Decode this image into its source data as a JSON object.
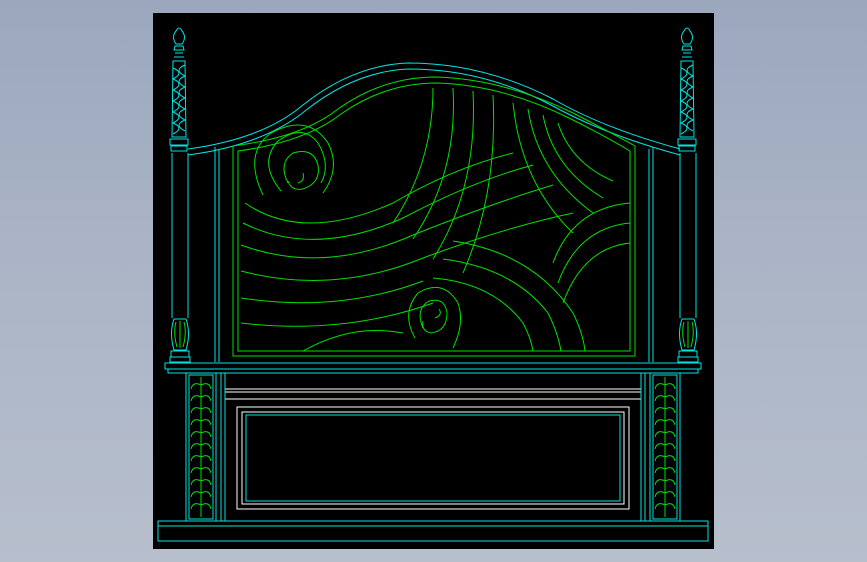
{
  "colors": {
    "background": "#a3afc2",
    "canvas": "#000000",
    "outline": "#00e5e5",
    "carving": "#00e000",
    "rail": "#ffffff"
  },
  "drawing": {
    "subject": "headboard-elevation"
  }
}
